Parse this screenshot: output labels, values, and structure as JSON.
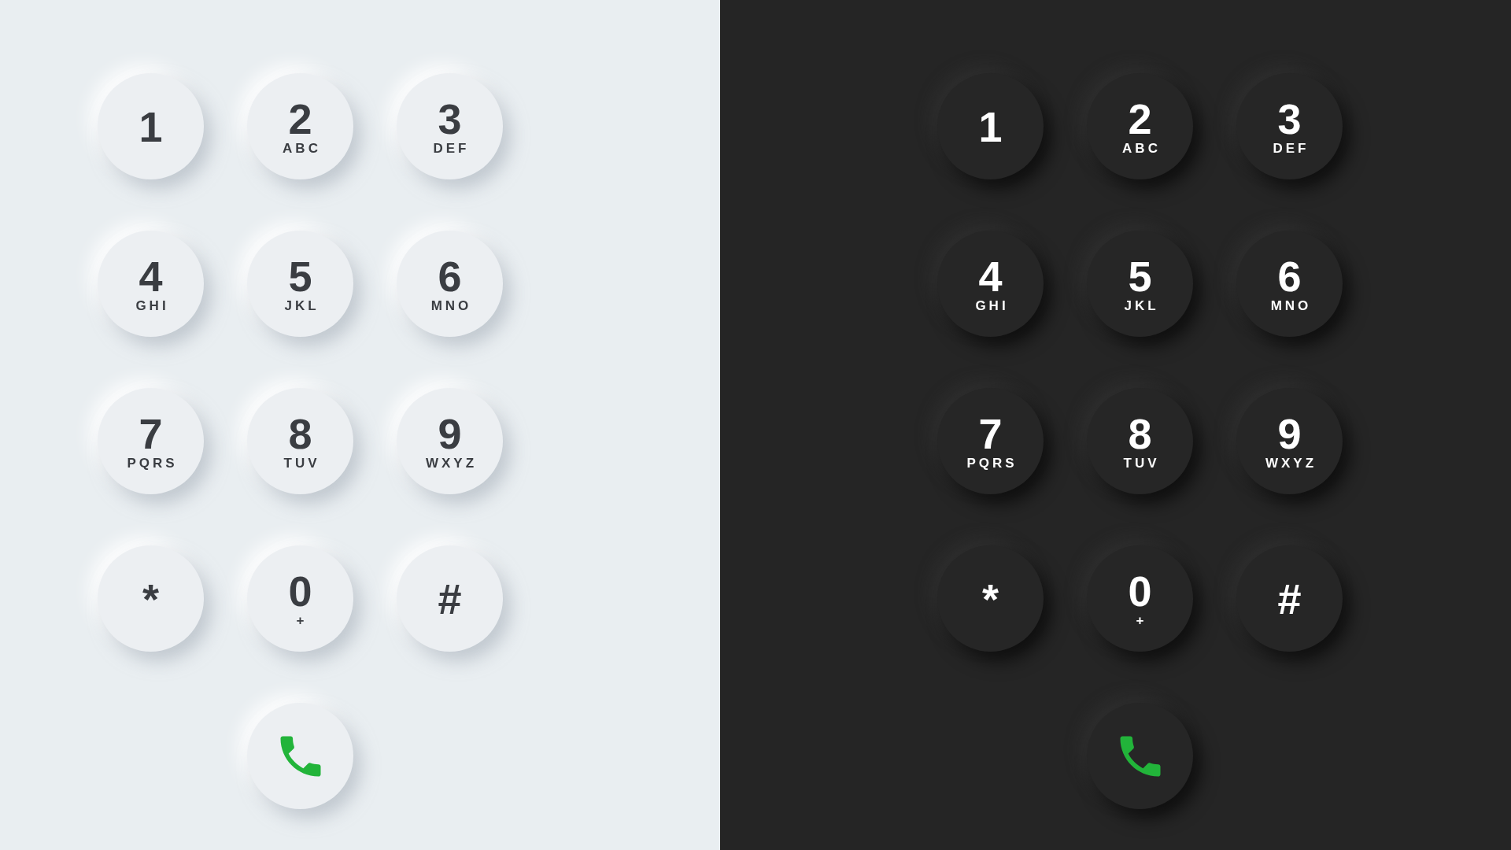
{
  "panels": [
    {
      "kind": "light",
      "keys": [
        {
          "digit": "1"
        },
        {
          "digit": "2",
          "letters": "ABC"
        },
        {
          "digit": "3",
          "letters": "DEF"
        },
        {
          "digit": "4",
          "letters": "GHI"
        },
        {
          "digit": "5",
          "letters": "JKL"
        },
        {
          "digit": "6",
          "letters": "MNO"
        },
        {
          "digit": "7",
          "letters": "PQRS"
        },
        {
          "digit": "8",
          "letters": "TUV"
        },
        {
          "digit": "9",
          "letters": "WXYZ"
        },
        {
          "digit": "*"
        },
        {
          "digit": "0",
          "letters": "+"
        },
        {
          "digit": "#"
        }
      ]
    },
    {
      "kind": "dark",
      "keys": [
        {
          "digit": "1"
        },
        {
          "digit": "2",
          "letters": "ABC"
        },
        {
          "digit": "3",
          "letters": "DEF"
        },
        {
          "digit": "4",
          "letters": "GHI"
        },
        {
          "digit": "5",
          "letters": "JKL"
        },
        {
          "digit": "6",
          "letters": "MNO"
        },
        {
          "digit": "7",
          "letters": "PQRS"
        },
        {
          "digit": "8",
          "letters": "TUV"
        },
        {
          "digit": "9",
          "letters": "WXYZ"
        },
        {
          "digit": "*"
        },
        {
          "digit": "0",
          "letters": "+"
        },
        {
          "digit": "#"
        }
      ]
    }
  ]
}
